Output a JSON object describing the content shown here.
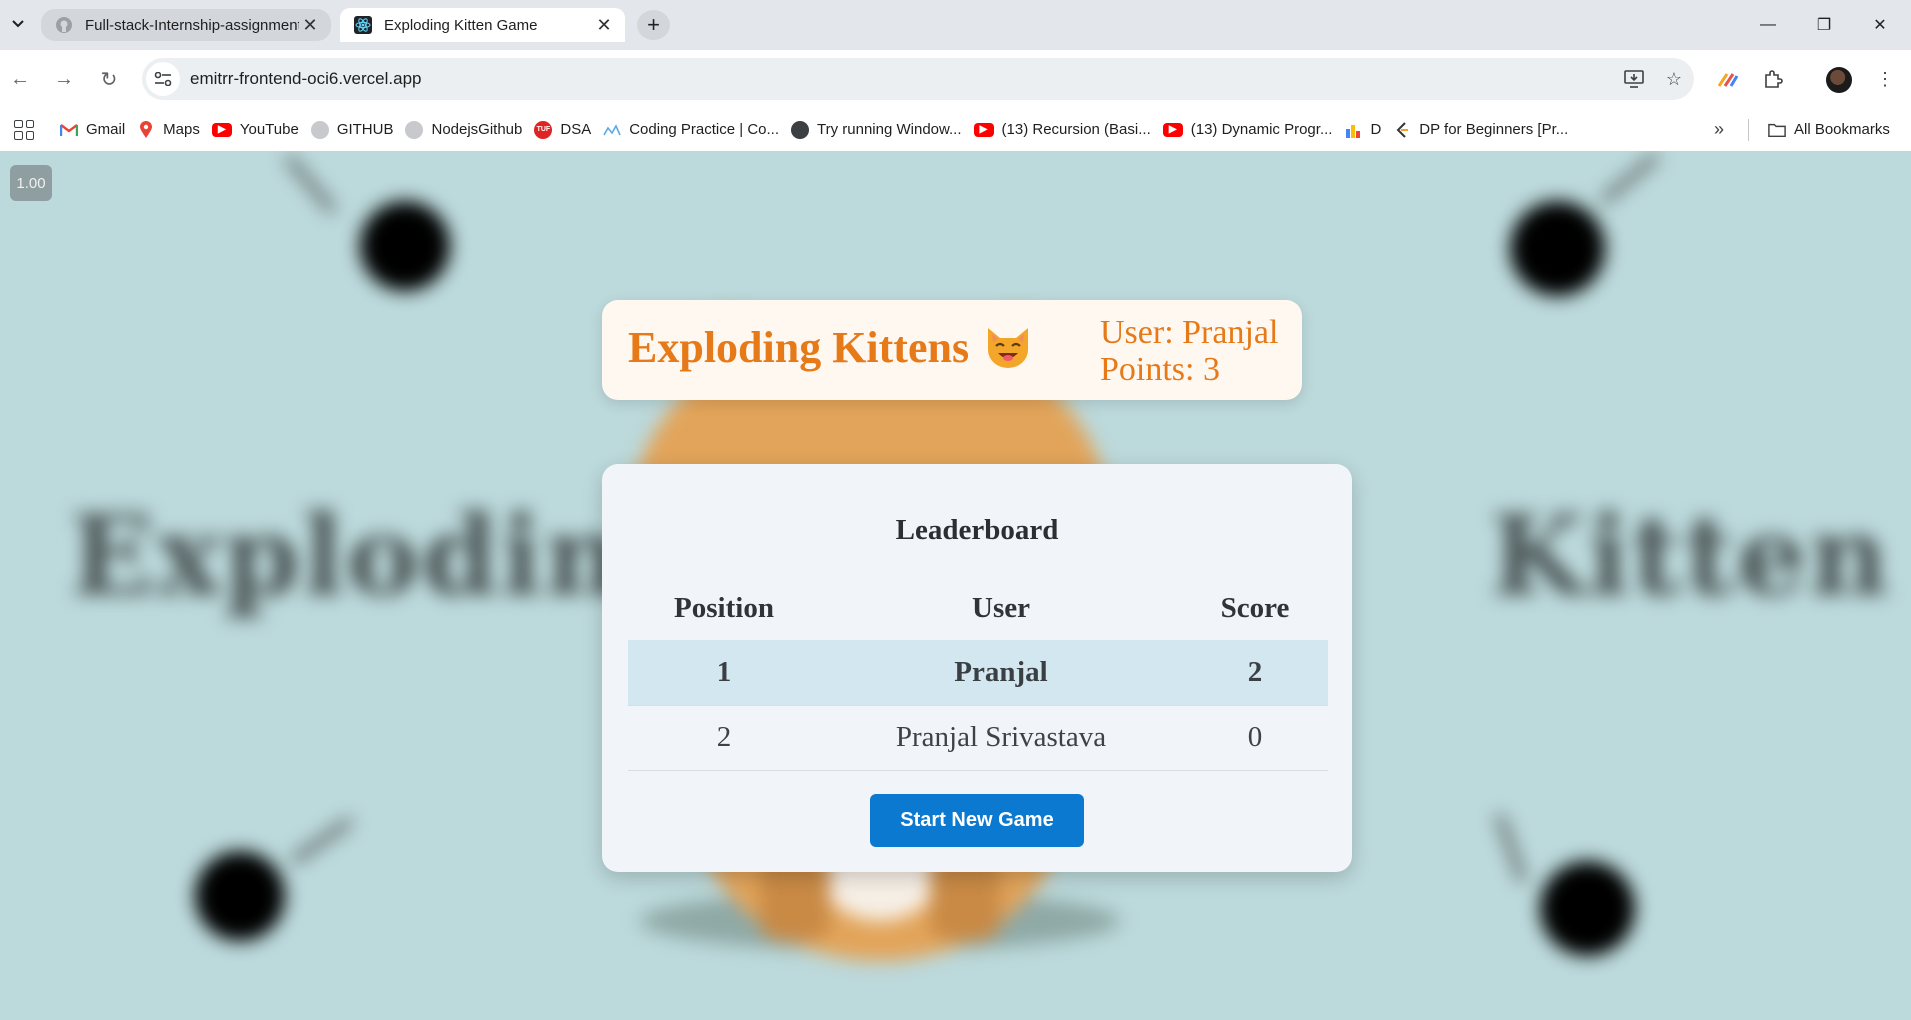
{
  "browser": {
    "tabs": [
      {
        "title": "Full-stack-Internship-assignment",
        "favicon": "github-icon",
        "active": false
      },
      {
        "title": "Exploding Kitten Game",
        "favicon": "react-icon",
        "active": true
      }
    ],
    "url": "emitrr-frontend-oci6.vercel.app",
    "bookmarks": [
      {
        "label": "Gmail",
        "icon": "gmail-icon"
      },
      {
        "label": "Maps",
        "icon": "maps-icon"
      },
      {
        "label": "YouTube",
        "icon": "youtube-icon"
      },
      {
        "label": "GITHUB",
        "icon": "github-icon"
      },
      {
        "label": "NodejsGithub",
        "icon": "github-icon"
      },
      {
        "label": "DSA",
        "icon": "tuf-icon"
      },
      {
        "label": "Coding Practice | Co...",
        "icon": "coding-icon"
      },
      {
        "label": "Try running Window...",
        "icon": "globe-icon"
      },
      {
        "label": "(13) Recursion (Basi...",
        "icon": "youtube-icon"
      },
      {
        "label": "(13) Dynamic Progr...",
        "icon": "youtube-icon"
      },
      {
        "label": "D",
        "icon": "chart-icon"
      },
      {
        "label": "DP for Beginners [Pr...",
        "icon": "leetcode-icon"
      }
    ],
    "all_bookmarks_label": "All Bookmarks"
  },
  "page": {
    "scale_badge": "1.00",
    "background_words": [
      "Exploding",
      "Kitten"
    ],
    "header": {
      "title": "Exploding Kittens",
      "emoji": "smiling-cat-icon",
      "user_line": "User: Pranjal",
      "points_line": "Points: 3"
    },
    "leaderboard": {
      "title": "Leaderboard",
      "columns": [
        "Position",
        "User",
        "Score"
      ],
      "rows": [
        {
          "position": "1",
          "user": "Pranjal",
          "score": "2",
          "highlight": true
        },
        {
          "position": "2",
          "user": "Pranjal Srivastava",
          "score": "0",
          "highlight": false
        }
      ],
      "button_label": "Start New Game"
    },
    "colors": {
      "accent_orange": "#e67a18",
      "button_blue": "#0a79cf",
      "highlight_row": "#d3e7f0",
      "page_bg": "#bcd9db"
    }
  }
}
